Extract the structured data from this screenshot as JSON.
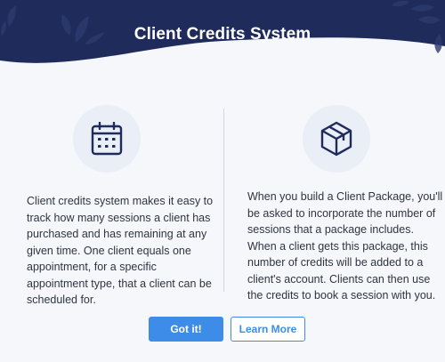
{
  "modal": {
    "title": "Client Credits System",
    "colors": {
      "header": "#1f2b5a",
      "accent": "#3d8de8",
      "icon": "#1f2b5a",
      "icon_bg": "#e9eef7"
    }
  },
  "left_column": {
    "icon": "calendar-icon",
    "text": "Client credits system makes it easy to track how many sessions a client has purchased and has remaining at any given time. One client equals one appointment, for a specific appointment type, that a client can be scheduled for."
  },
  "right_column": {
    "icon": "package-box-icon",
    "text": "When you build a Client Package, you'll be asked to incorporate the number of sessions that a package includes. When a client gets this package, this number of credits will be added to a client's account. Clients can then use the credits to book a session with you."
  },
  "buttons": {
    "primary_label": "Got it!",
    "secondary_label": "Learn More"
  }
}
